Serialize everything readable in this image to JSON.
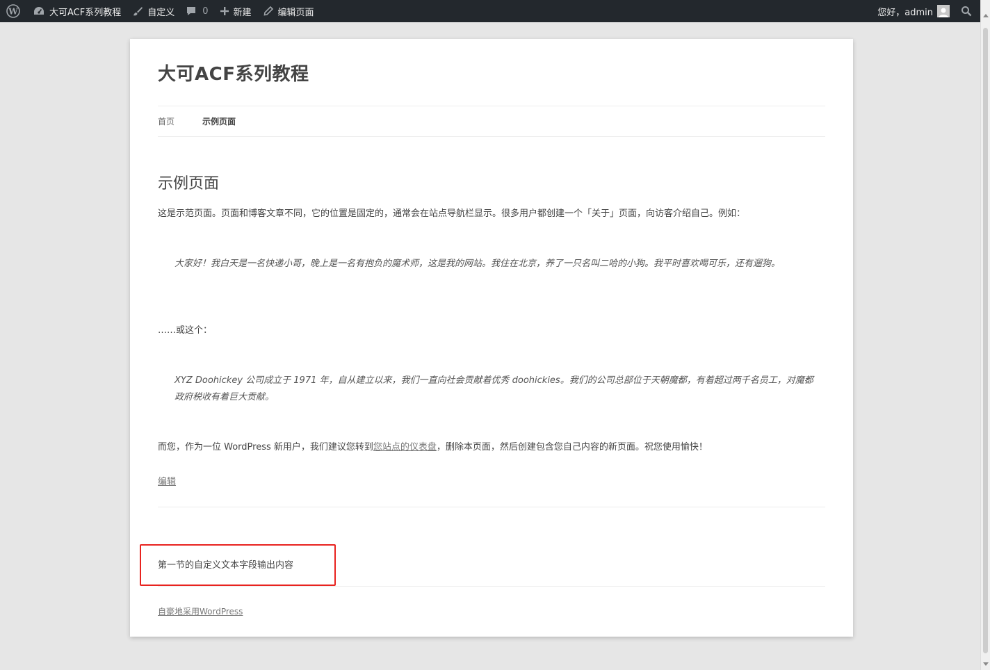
{
  "adminbar": {
    "site_name": "大可ACF系列教程",
    "customize": "自定义",
    "comments_count": "0",
    "new": "新建",
    "edit_page": "编辑页面",
    "greeting": "您好，admin"
  },
  "site": {
    "title": "大可ACF系列教程"
  },
  "nav": {
    "items": [
      "首页",
      "示例页面"
    ]
  },
  "entry": {
    "title": "示例页面",
    "intro": "这是示范页面。页面和博客文章不同，它的位置是固定的，通常会在站点导航栏显示。很多用户都创建一个「关于」页面，向访客介绍自己。例如：",
    "quote1": "大家好！我白天是一名快递小哥，晚上是一名有抱负的魔术师，这是我的网站。我住在北京，养了一只名叫二哈的小狗。我平时喜欢喝可乐，还有遛狗。",
    "or_this": "……或这个：",
    "quote2": "XYZ Doohickey 公司成立于 1971 年，自从建立以来，我们一直向社会贡献着优秀 doohickies。我们的公司总部位于天朝魔都，有着超过两千名员工，对魔都政府税收有着巨大贡献。",
    "closing_before": "而您，作为一位 WordPress 新用户，我们建议您转到",
    "closing_link": "您站点的仪表盘",
    "closing_after": "，删除本页面，然后创建包含您自己内容的新页面。祝您使用愉快！",
    "edit": "编辑"
  },
  "custom_field": {
    "text": "第一节的自定义文本字段输出内容",
    "highlight_color": "#e8231f"
  },
  "footer": {
    "credits": "自豪地采用WordPress"
  }
}
